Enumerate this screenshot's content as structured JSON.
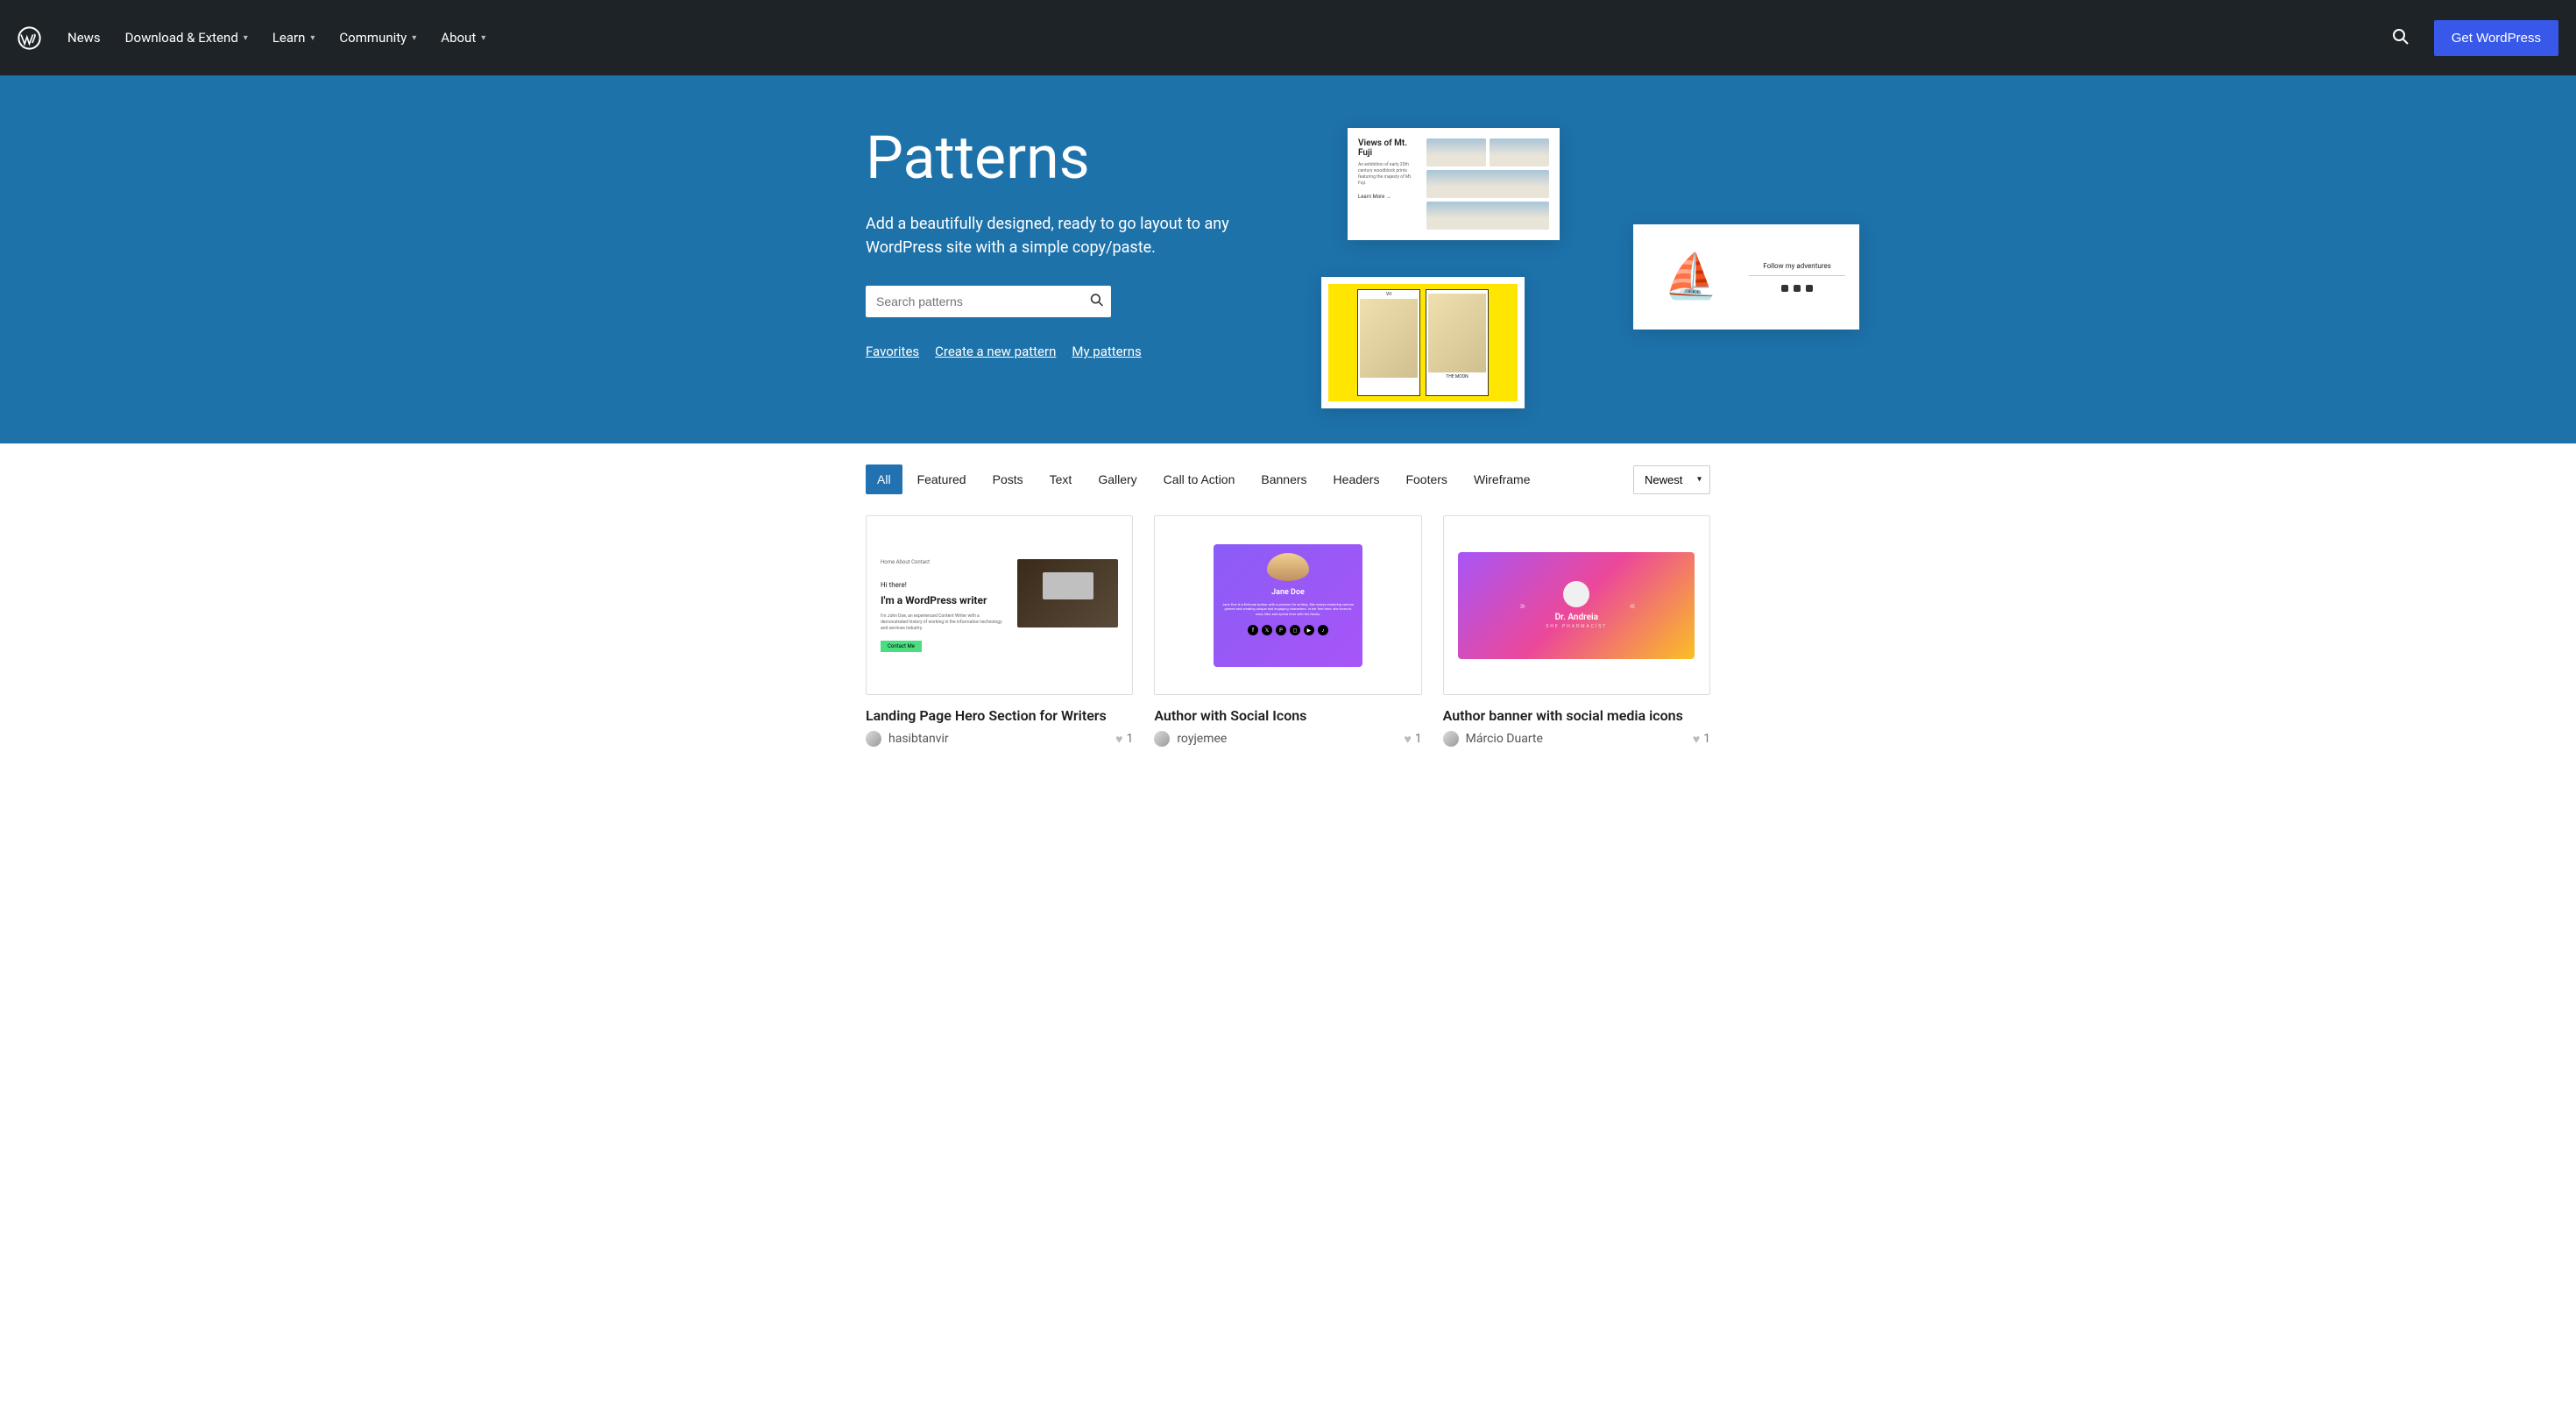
{
  "nav": {
    "news": "News",
    "download": "Download & Extend",
    "learn": "Learn",
    "community": "Community",
    "about": "About",
    "get_wp": "Get WordPress"
  },
  "hero": {
    "title": "Patterns",
    "desc": "Add a beautifully designed, ready to go layout to any WordPress site with a simple copy/paste.",
    "search_placeholder": "Search patterns",
    "links": {
      "favorites": "Favorites",
      "create": "Create a new pattern",
      "my": "My patterns"
    },
    "mockup1": {
      "title": "Views of Mt. Fuji",
      "desc": "An exhibition of early 20th century woodblock prints featuring the majesty of Mt. Fuji.",
      "link": "Learn More →"
    },
    "mockup2": {
      "follow": "Follow my adventures"
    },
    "mockup3": {
      "card1_top": "VII",
      "card2_bottom": "THE MOON"
    }
  },
  "filters": {
    "items": [
      "All",
      "Featured",
      "Posts",
      "Text",
      "Gallery",
      "Call to Action",
      "Banners",
      "Headers",
      "Footers",
      "Wireframe"
    ],
    "sort": "Newest"
  },
  "cards": [
    {
      "title": "Landing Page Hero Section for Writers",
      "author": "hasibtanvir",
      "likes": "1",
      "preview": {
        "nav": "Home   About   Contact",
        "hi": "Hi there!",
        "heading": "I'm a WordPress writer",
        "desc": "I'm John Doe, an experienced Content Writer with a demonstrated history of working in the information technology and services industry.",
        "btn": "Contact Me"
      }
    },
    {
      "title": "Author with Social Icons",
      "author": "royjemee",
      "likes": "1",
      "preview": {
        "name": "Jane Doe",
        "desc": "Jane Doe is a fictional author with a passion for writing. She enjoys exploring various genres and creating unique and engaging characters. In her free time, she loves to read, hike, and spend time with her family."
      }
    },
    {
      "title": "Author banner with social media icons",
      "author": "Márcio Duarte",
      "likes": "1",
      "preview": {
        "name": "Dr. Andreia",
        "role": "SHE PHARMACIST"
      }
    }
  ]
}
